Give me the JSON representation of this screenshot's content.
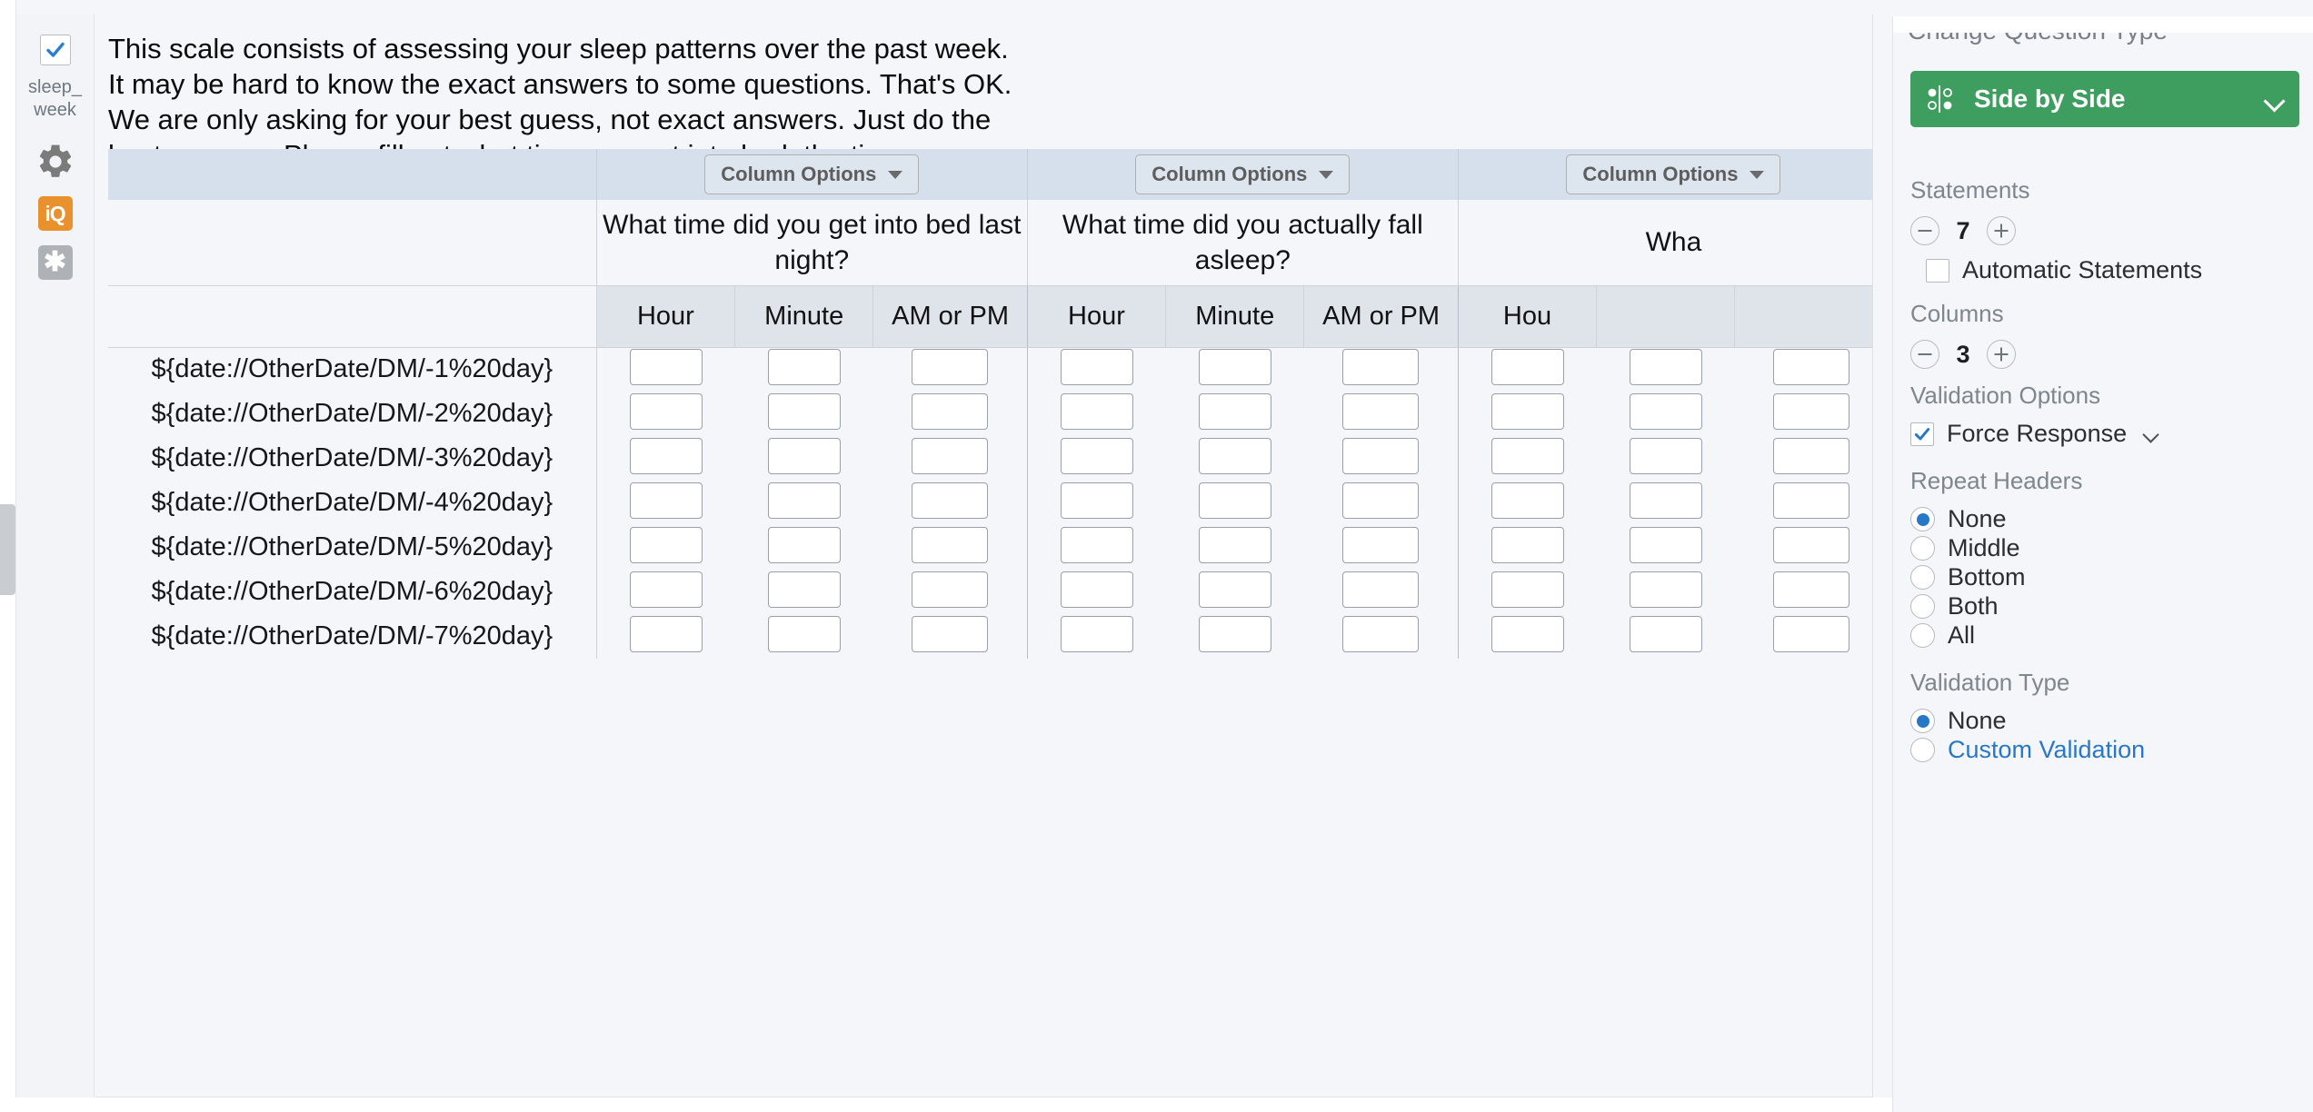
{
  "sidebar": {
    "question_checkbox_checked": true,
    "question_label": "sleep_week",
    "gear_icon": "gear-icon",
    "iq_badge": "iQ",
    "star_badge": "✱"
  },
  "main": {
    "intro_text": "This scale consists of assessing your sleep patterns over the past week. It may be hard to know the exact answers to some questions. That's OK. We are only asking for your best guess, not exact answers. Just do the best you can. Please fill out what time you got into bed, the time you actually fell asleep, and the time you woke up.",
    "column_options_label": "Column Options",
    "columns": [
      {
        "question": "What time did you get into bed last night?",
        "subheaders": [
          "Hour",
          "Minute",
          "AM or PM"
        ]
      },
      {
        "question": "What time did you actually fall asleep?",
        "subheaders": [
          "Hour",
          "Minute",
          "AM or PM"
        ]
      },
      {
        "question": "Wha",
        "subheaders": [
          "Hou",
          "",
          ""
        ]
      }
    ],
    "statements": [
      "${date://OtherDate/DM/-1%20day}",
      "${date://OtherDate/DM/-2%20day}",
      "${date://OtherDate/DM/-3%20day}",
      "${date://OtherDate/DM/-4%20day}",
      "${date://OtherDate/DM/-5%20day}",
      "${date://OtherDate/DM/-6%20day}",
      "${date://OtherDate/DM/-7%20day}"
    ],
    "remove_button": "−",
    "add_button": "+"
  },
  "right_panel": {
    "panel_title": "Change Question Type",
    "question_type": "Side by Side",
    "statements_section": {
      "label": "Statements",
      "count": "7",
      "automatic_label": "Automatic Statements",
      "automatic_checked": false
    },
    "columns_section": {
      "label": "Columns",
      "count": "3"
    },
    "validation_options": {
      "label": "Validation Options",
      "force_response_label": "Force Response",
      "force_response_checked": true
    },
    "repeat_headers": {
      "label": "Repeat Headers",
      "options": [
        "None",
        "Middle",
        "Bottom",
        "Both",
        "All"
      ],
      "selected": "None"
    },
    "validation_type": {
      "label": "Validation Type",
      "options": [
        "None",
        "Custom Validation"
      ],
      "selected": "None"
    }
  },
  "colors": {
    "accent_green": "#3d9e5f",
    "accent_blue": "#2878c8",
    "remove_red": "#c94f47",
    "add_green": "#4aab6e",
    "iq_orange": "#e8912d",
    "header_blue": "#d6dfec"
  }
}
